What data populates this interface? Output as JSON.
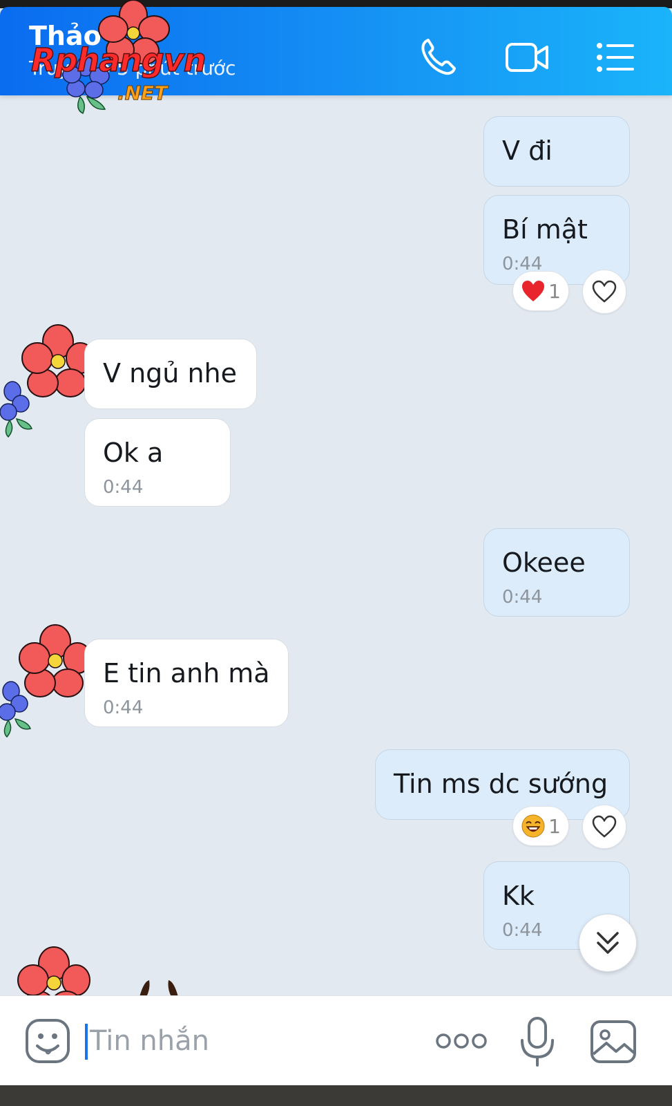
{
  "header": {
    "contact_name": "Thảo",
    "status": "Truy cập 5 phút trước",
    "watermark": "Rphangvn",
    "watermark_sub": ".NET",
    "icons": [
      "phone-icon",
      "video-camera-icon",
      "list-menu-icon"
    ]
  },
  "messages": [
    {
      "side": "out",
      "text": "V đi",
      "time": ""
    },
    {
      "side": "out",
      "text": "Bí mật",
      "time": "0:44",
      "reaction": {
        "emoji": "heart",
        "count": "1"
      }
    },
    {
      "side": "in",
      "text": "V ngủ nhe",
      "time": ""
    },
    {
      "side": "in",
      "text": "Ok a",
      "time": "0:44"
    },
    {
      "side": "out",
      "text": "Okeee",
      "time": "0:44"
    },
    {
      "side": "in",
      "text": "E tin anh mà",
      "time": "0:44"
    },
    {
      "side": "out",
      "text": "Tin ms dc sướng",
      "time": "",
      "reaction": {
        "emoji": "laughing",
        "count": "1"
      }
    },
    {
      "side": "out",
      "text": "Kk",
      "time": "0:44"
    }
  ],
  "composer": {
    "placeholder": "Tin nhắn"
  },
  "colors": {
    "header_start": "#0a6cf0",
    "header_end": "#1ab4fa",
    "chat_bg": "#e2e9f1",
    "outgoing_bubble": "#dcecfb",
    "incoming_bubble": "#ffffff"
  }
}
